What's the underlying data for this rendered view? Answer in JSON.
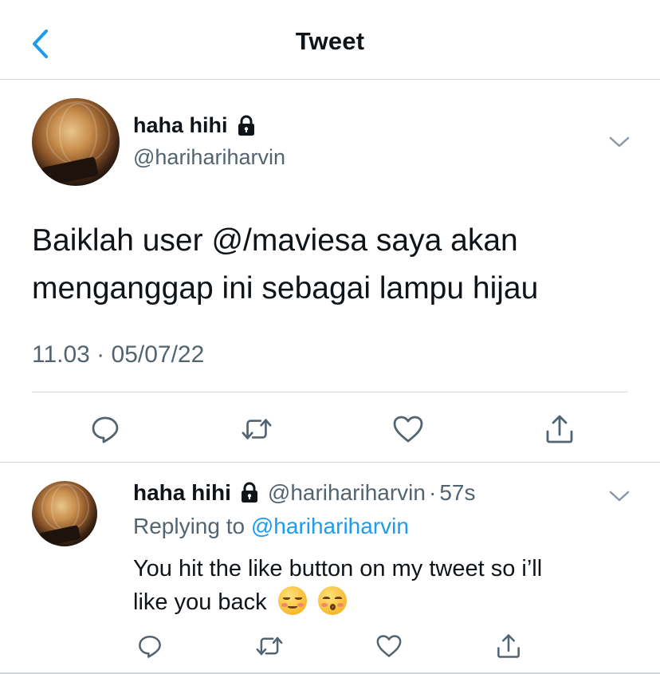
{
  "header": {
    "title": "Tweet"
  },
  "colors": {
    "accent": "#1d9bf0",
    "text": "#0f1419",
    "muted": "#536471",
    "divider": "#d6d9dc"
  },
  "main_tweet": {
    "display_name": "haha hihi",
    "handle": "@harihariharvin",
    "protected_icon": "lock-icon",
    "text_line_1": "Baiklah user @/maviesa saya akan",
    "text_line_2": "menganggap ini sebagai lampu hijau",
    "timestamp": "11.03 · 05/07/22",
    "actions": [
      "reply-icon",
      "retweet-icon",
      "like-icon",
      "share-icon"
    ]
  },
  "reply": {
    "display_name": "haha hihi",
    "handle": "@harihariharvin",
    "separator": "·",
    "age": "57s",
    "replying_prefix": "Replying to",
    "replying_to": "@harihariharvin",
    "text_line_1": "You hit the like button on my tweet so i’ll",
    "text_line_2": "like you back",
    "emojis": [
      "relieved-face-emoji",
      "kissing-smiling-eyes-emoji"
    ],
    "actions": [
      "reply-icon",
      "retweet-icon",
      "like-icon",
      "share-icon"
    ]
  }
}
